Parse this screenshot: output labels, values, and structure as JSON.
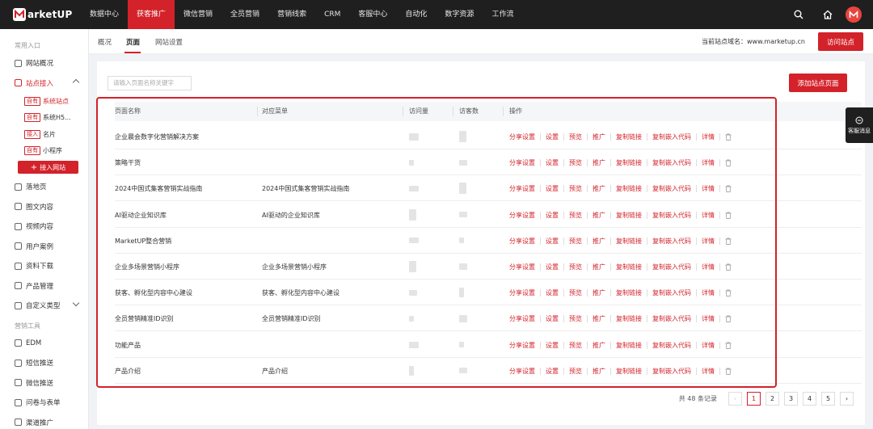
{
  "logo": {
    "text": "arketUP"
  },
  "nav": {
    "items": [
      "数据中心",
      "获客推广",
      "微信营销",
      "全员营销",
      "营销线索",
      "CRM",
      "客服中心",
      "自动化",
      "数字资源",
      "工作流"
    ],
    "active_index": 1
  },
  "sidebar": {
    "group1": "常用入口",
    "items_top": [
      {
        "label": "网站概况"
      },
      {
        "label": "站点接入"
      }
    ],
    "sub_items": [
      {
        "tag": "自有",
        "label": "系统站点"
      },
      {
        "tag": "自有",
        "label": "系统H5..."
      },
      {
        "tag": "接入",
        "label": "名片"
      },
      {
        "tag": "自有",
        "label": "小程序"
      }
    ],
    "add_site": "接入网站",
    "items_mid": [
      {
        "label": "落地页"
      },
      {
        "label": "图文内容"
      },
      {
        "label": "视频内容"
      },
      {
        "label": "用户案例"
      },
      {
        "label": "资料下载"
      },
      {
        "label": "产品管理"
      },
      {
        "label": "自定义类型"
      }
    ],
    "group2": "营销工具",
    "items_bottom": [
      {
        "label": "EDM"
      },
      {
        "label": "短信推送"
      },
      {
        "label": "微信推送"
      },
      {
        "label": "问卷与表单"
      },
      {
        "label": "渠道推广"
      }
    ]
  },
  "tabs": {
    "items": [
      "概况",
      "页面",
      "网站设置"
    ],
    "active_index": 1
  },
  "header": {
    "domain": "当前站点域名：www.marketup.cn",
    "visit_btn": "访问站点"
  },
  "toolbar": {
    "search_placeholder": "请输入页面名称关键字",
    "add_page_btn": "添加站点页面"
  },
  "table": {
    "columns": [
      "页面名称",
      "对应菜单",
      "访问量",
      "访客数",
      "操作"
    ],
    "rows": [
      {
        "name": "企业晨会数字化营销解决方案",
        "menu": ""
      },
      {
        "name": "策略干货",
        "menu": ""
      },
      {
        "name": "2024中国式集客营销实战指南",
        "menu": "2024中国式集客营销实战指南"
      },
      {
        "name": "AI驱动企业知识库",
        "menu": "AI驱动的企业知识库"
      },
      {
        "name": "MarketUP整合营销",
        "menu": ""
      },
      {
        "name": "企业多场景营销小程序",
        "menu": "企业多场景营销小程序"
      },
      {
        "name": "获客、孵化型内容中心建设",
        "menu": "获客、孵化型内容中心建设"
      },
      {
        "name": "全员营销精准ID识别",
        "menu": "全员营销精准ID识别"
      },
      {
        "name": "功能产品",
        "menu": ""
      },
      {
        "name": "产品介绍",
        "menu": "产品介绍"
      }
    ],
    "operations": [
      "分享设置",
      "设置",
      "预览",
      "推广",
      "复制链接",
      "复制嵌入代码",
      "详情"
    ]
  },
  "pagination": {
    "total": "共 48 条记录",
    "pages": [
      "1",
      "2",
      "3",
      "4",
      "5"
    ],
    "current": "1"
  },
  "float_service": {
    "label": "客服消息"
  },
  "colors": {
    "brand": "#d3222a",
    "topbar": "#1f1f1f"
  }
}
